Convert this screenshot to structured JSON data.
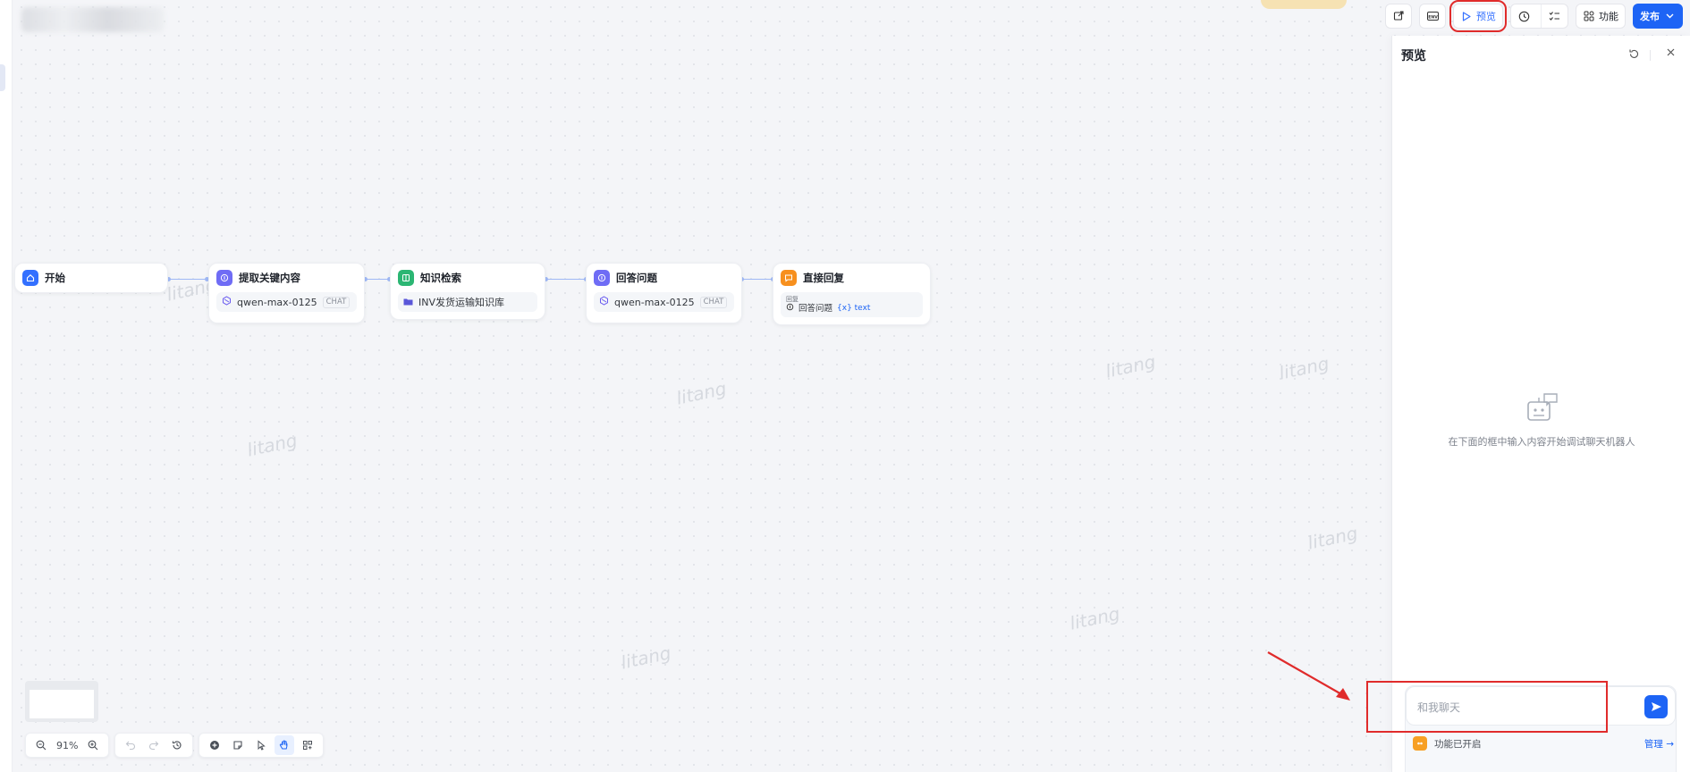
{
  "toolbar": {
    "preview_label": "预览",
    "features_label": "功能",
    "publish_label": "发布"
  },
  "nodes": [
    {
      "title": "开始",
      "color": "#3370ff"
    },
    {
      "title": "提取关键内容",
      "color": "#6f6cf5",
      "model": "qwen-max-0125",
      "tag": "CHAT"
    },
    {
      "title": "知识检索",
      "color": "#2bb673",
      "dataset": "INV发货运输知识库"
    },
    {
      "title": "回答问题",
      "color": "#6f6cf5",
      "model": "qwen-max-0125",
      "tag": "CHAT"
    },
    {
      "title": "直接回复",
      "color": "#f7901e",
      "reply_label": "回复",
      "reply_source": "回答问题",
      "reply_var": "{x} text"
    }
  ],
  "preview": {
    "title": "预览",
    "empty_hint": "在下面的框中输入内容开始调试聊天机器人",
    "input_placeholder": "和我聊天",
    "features_status": "功能已开启",
    "manage_label": "管理 →"
  },
  "zoom": {
    "level": "91%"
  },
  "watermark": "litang"
}
